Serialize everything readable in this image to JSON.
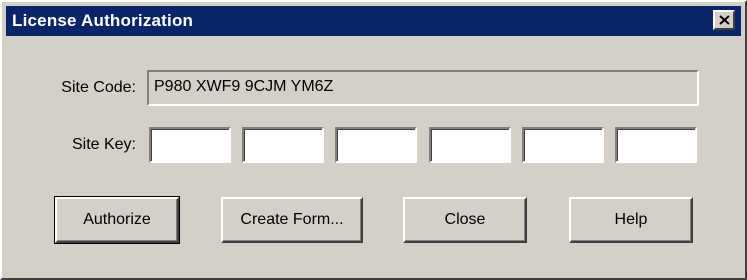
{
  "window": {
    "title": "License Authorization",
    "close_icon": "close-icon",
    "titlebar_color": "#0a246a",
    "face_color": "#d4d0c8"
  },
  "form": {
    "site_code_label": "Site Code:",
    "site_code_value": "P980 XWF9 9CJM YM6Z",
    "site_key_label": "Site Key:",
    "site_key_values": [
      "",
      "",
      "",
      "",
      "",
      ""
    ]
  },
  "buttons": {
    "authorize": "Authorize",
    "create_form": "Create Form...",
    "close": "Close",
    "help": "Help"
  }
}
